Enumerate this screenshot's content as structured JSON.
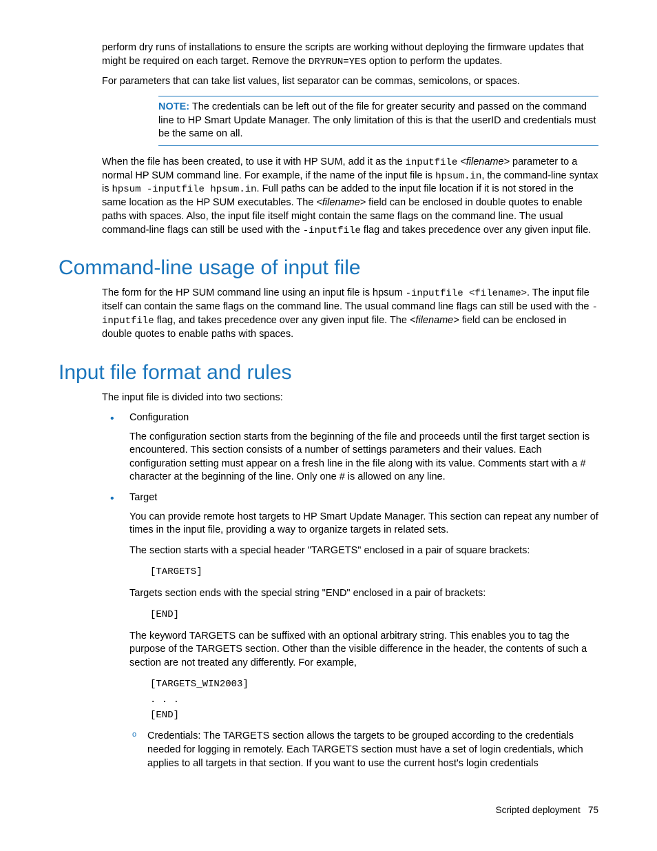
{
  "para1_a": "perform dry runs of installations to ensure the scripts are working without deploying the firmware updates that might be required on each target. Remove the ",
  "para1_code": "DRYRUN=YES",
  "para1_b": " option to perform the updates.",
  "para2": "For parameters that can take list values, list separator can be commas, semicolons, or spaces.",
  "note_label": "NOTE:",
  "note_text": " The credentials can be left out of the file for greater security and passed on the command line to HP Smart Update Manager. The only limitation of this is that the userID and credentials must be the same on all.",
  "para3_a": "When the file has been created, to use it with HP SUM, add it as the ",
  "para3_code1": "inputfile",
  "para3_b": " ",
  "para3_it1": "<filename>",
  "para3_c": " parameter to a normal HP SUM command line. For example, if the name of the input file is ",
  "para3_code2": "hpsum.in",
  "para3_d": ", the command-line syntax is ",
  "para3_code3": "hpsum -inputfile hpsum.in",
  "para3_e": ". Full paths can be added to the input file location if it is not stored in the same location as the HP SUM executables. The ",
  "para3_it2": "<filename>",
  "para3_f": " field can be enclosed in double quotes to enable paths with spaces. Also, the input file itself might contain the same flags on the command line. The usual command-line flags can still be used with the ",
  "para3_code4": "-inputfile",
  "para3_g": " flag and takes precedence over any given input file.",
  "h1": "Command-line usage of input file",
  "para4_a": "The form for the HP SUM command line using an input file is hpsum ",
  "para4_code1": "-inputfile <filename>",
  "para4_b": ". The input file itself can contain the same flags on the command line. The usual command line flags can still be used with the ",
  "para4_code2": "-inputfile",
  "para4_c": " flag, and takes precedence over any given input file. The ",
  "para4_it1": "<filename>",
  "para4_d": " field can be enclosed in double quotes to enable paths with spaces.",
  "h2": "Input file format and rules",
  "para5": "The input file is divided into two sections:",
  "li1_title": "Configuration",
  "li1_body": "The configuration section starts from the beginning of the file and proceeds until the first target section is encountered. This section consists of a number of settings parameters and their values. Each configuration setting must appear on a fresh line in the file along with its value. Comments start with a # character at the beginning of the line. Only one # is allowed on any line.",
  "li2_title": "Target",
  "li2_p1": "You can provide remote host targets to HP Smart Update Manager. This section can repeat any number of times in the input file, providing a way to organize targets in related sets.",
  "li2_p2": "The section starts with a special header \"TARGETS\" enclosed in a pair of square brackets:",
  "li2_code1": "[TARGETS]",
  "li2_p3": "Targets section ends with the special string \"END\" enclosed in a pair of brackets:",
  "li2_code2": "[END]",
  "li2_p4": "The keyword TARGETS can be suffixed with an optional arbitrary string. This enables you to tag the purpose of the TARGETS section. Other than the visible difference in the header, the contents of such a section are not treated any differently. For example,",
  "li2_code3a": "[TARGETS_WIN2003]",
  "li2_code3b": ". . .",
  "li2_code3c": "[END]",
  "sub1": "Credentials: The TARGETS section allows the targets to be grouped according to the credentials needed for logging in remotely. Each TARGETS section must have a set of login credentials, which applies to all targets in that section. If you want to use the current host's login credentials",
  "footer_text": "Scripted deployment",
  "footer_page": "75"
}
